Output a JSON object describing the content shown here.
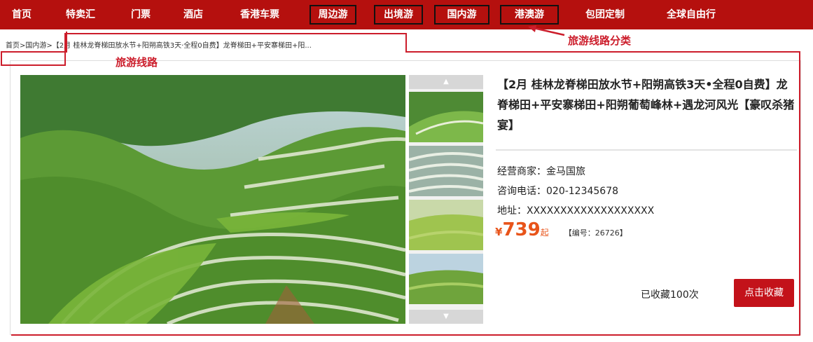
{
  "nav": {
    "items": [
      {
        "label": "首页"
      },
      {
        "label": "特卖汇"
      },
      {
        "label": "门票"
      },
      {
        "label": "酒店"
      },
      {
        "label": "香港车票"
      },
      {
        "label": "周边游"
      },
      {
        "label": "出境游"
      },
      {
        "label": "国内游"
      },
      {
        "label": "港澳游"
      },
      {
        "label": "包团定制"
      },
      {
        "label": "全球自由行"
      }
    ]
  },
  "breadcrumb": {
    "home": "首页",
    "sep": ">",
    "category": "国内游",
    "current": "【2月 桂林龙脊梯田放水节+阳朔高铁3天·全程0自费】龙脊梯田+平安寨梯田+阳..."
  },
  "annotations": {
    "category_label": "旅游线路分类",
    "route_label": "旅游线路"
  },
  "product": {
    "title": "【2月 桂林龙脊梯田放水节+阳朔高铁3天•全程0自费】龙脊梯田+平安寨梯田+阳朔葡萄峰林+遇龙河风光【豪叹杀猪宴】",
    "merchant": "经营商家：金马国旅",
    "phone": "咨询电话：020-12345678",
    "address": "地址：XXXXXXXXXXXXXXXXXXX",
    "currency": "¥",
    "price": "739",
    "price_suffix": "起",
    "code": "【编号：26726】",
    "favorites": "已收藏100次",
    "favorite_button": "点击收藏"
  },
  "gallery": {
    "up_arrow": "▲",
    "down_arrow": "▼"
  },
  "colors": {
    "nav_bg": "#b5100e",
    "accent_red": "#cc1d2b",
    "price_orange": "#e8541a",
    "button_red": "#c3121a"
  }
}
